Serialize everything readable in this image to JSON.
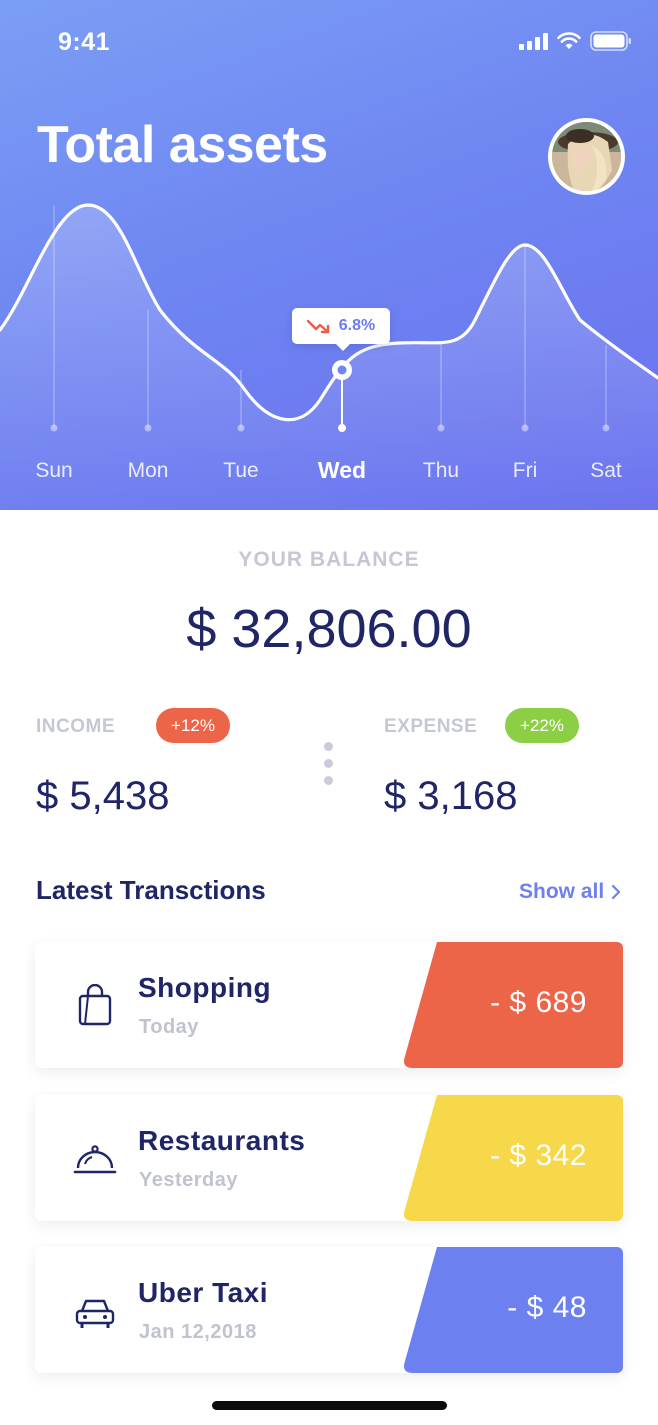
{
  "status_bar": {
    "time": "9:41"
  },
  "header": {
    "title": "Total assets"
  },
  "chart_data": {
    "type": "line",
    "categories": [
      "Sun",
      "Mon",
      "Tue",
      "Wed",
      "Thu",
      "Fri",
      "Sat"
    ],
    "selected": "Wed",
    "change_label": "6.8%",
    "change_direction": "down",
    "grid": false,
    "legend": "none"
  },
  "balance": {
    "label": "YOUR BALANCE",
    "value": "$ 32,806.00"
  },
  "income": {
    "label": "INCOME",
    "badge": "+12%",
    "value": "$ 5,438",
    "badge_color": "#ec6548"
  },
  "expense": {
    "label": "EXPENSE",
    "badge": "+22%",
    "value": "$ 3,168",
    "badge_color": "#8ccf44"
  },
  "transactions_section": {
    "title": "Latest Transctions",
    "show_all": "Show all"
  },
  "transactions": [
    {
      "name": "Shopping",
      "date": "Today",
      "amount": "- $ 689",
      "color": "#ec6548",
      "icon": "shopping-bag-icon"
    },
    {
      "name": "Restaurants",
      "date": "Yesterday",
      "amount": "- $ 342",
      "color": "#f6d84a",
      "icon": "cloche-icon"
    },
    {
      "name": "Uber Taxi",
      "date": "Jan 12,2018",
      "amount": "- $ 48",
      "color": "#6c80f0",
      "icon": "car-icon"
    }
  ],
  "colors": {
    "primary": "#6f86f2",
    "navy": "#1f2566",
    "muted": "#c5c8d4"
  }
}
